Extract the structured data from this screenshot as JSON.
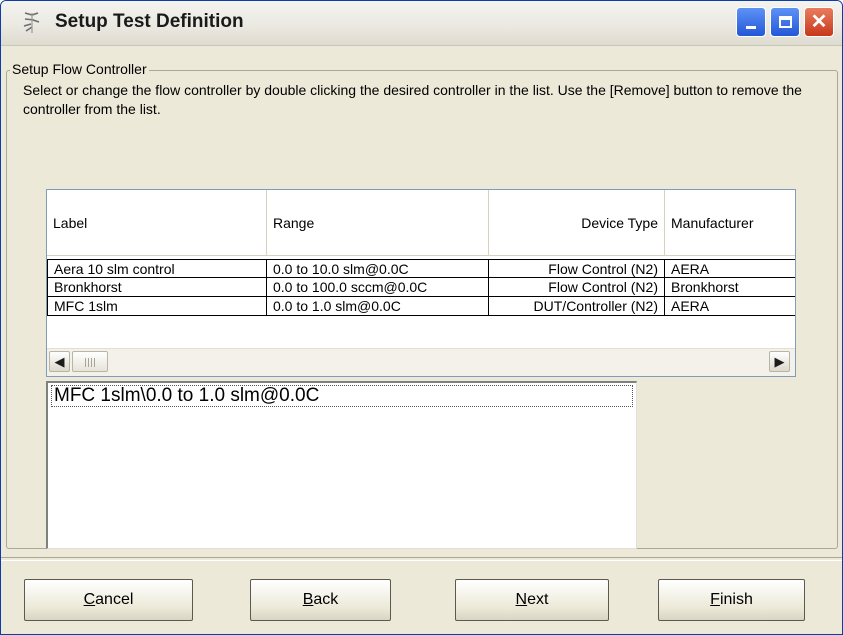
{
  "window": {
    "title": "Setup Test Definition"
  },
  "group": {
    "legend": "Setup Flow Controller",
    "instructions": "Select or change the flow controller by double clicking the desired controller in the list.  Use the [Remove] button to remove the controller from the list."
  },
  "listview": {
    "columns": [
      "Label",
      "Range",
      "Device Type",
      "Manufacturer"
    ],
    "rows": [
      [
        "Aera 10 slm control",
        "0.0 to 10.0 slm@0.0C",
        "Flow Control (N2)",
        "AERA"
      ],
      [
        "Bronkhorst",
        "0.0 to 100.0 sccm@0.0C",
        "Flow Control (N2)",
        "Bronkhorst"
      ],
      [
        "MFC 1slm",
        "0.0 to 1.0 slm@0.0C",
        "DUT/Controller (N2)",
        "AERA"
      ]
    ]
  },
  "selection": {
    "value": "MFC 1slm\\0.0 to 1.0 slm@0.0C"
  },
  "buttons": {
    "cancel": {
      "mnemonic": "C",
      "rest": "ancel"
    },
    "back": {
      "mnemonic": "B",
      "rest": "ack"
    },
    "next": {
      "mnemonic": "N",
      "rest": "ext"
    },
    "finish": {
      "mnemonic": "F",
      "rest": "inish"
    }
  },
  "icons": {
    "app": "app-icon",
    "minimize": "minimize-icon",
    "maximize": "maximize-icon",
    "close": "close-icon",
    "scroll_left": "scroll-left-arrow-icon",
    "scroll_right": "scroll-right-arrow-icon"
  },
  "colors": {
    "dialog_face": "#ece9d8",
    "close_button": "#c8381b",
    "window_buttons": "#2457d7"
  }
}
